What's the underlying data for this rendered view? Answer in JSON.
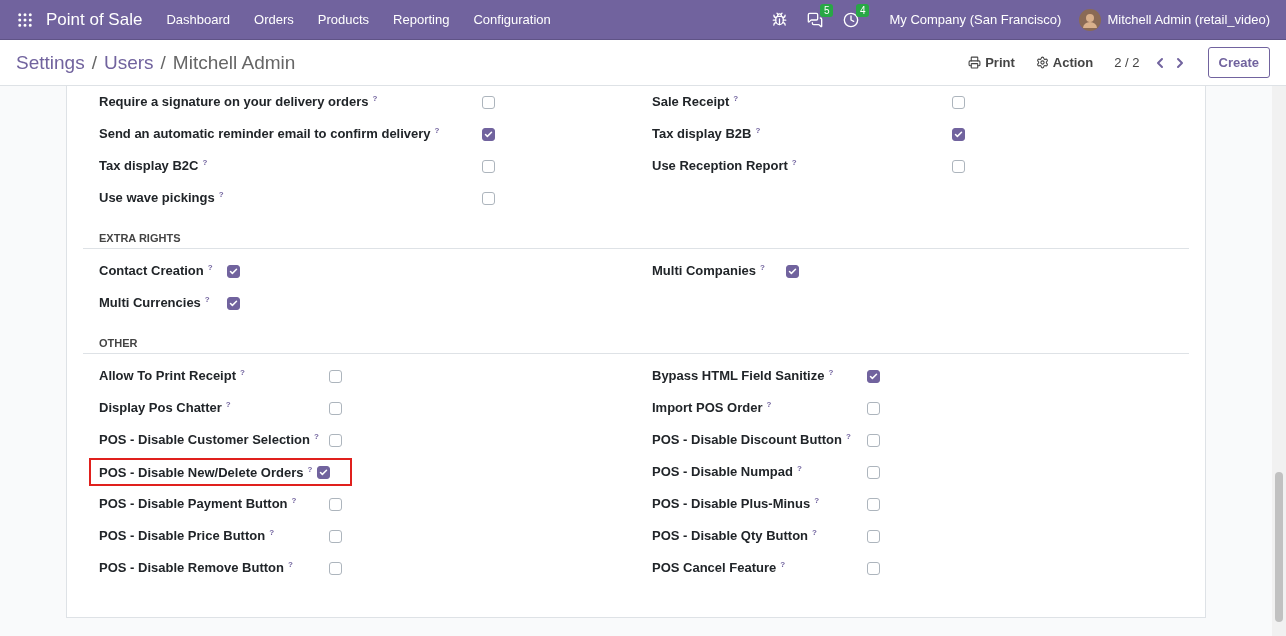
{
  "navbar": {
    "app": "Point of Sale",
    "menu": [
      "Dashboard",
      "Orders",
      "Products",
      "Reporting",
      "Configuration"
    ],
    "messages_badge": "5",
    "activities_badge": "4",
    "company": "My Company (San Francisco)",
    "user": "Mitchell Admin (retail_video)"
  },
  "control_panel": {
    "breadcrumb": [
      {
        "label": "Settings",
        "link": true
      },
      {
        "label": "Users",
        "link": true
      },
      {
        "label": "Mitchell Admin",
        "link": false
      }
    ],
    "separator": "/",
    "print": "Print",
    "action": "Action",
    "pager": "2 / 2",
    "create": "Create"
  },
  "sections": [
    {
      "rows": [
        {
          "left": {
            "label": "Require a signature on your delivery orders",
            "help": "?",
            "checked": false
          },
          "right": {
            "label": "Sale Receipt",
            "help": "?",
            "checked": false
          }
        },
        {
          "left": {
            "label": "Send an automatic reminder email to confirm delivery",
            "help": "?",
            "checked": true
          },
          "right": {
            "label": "Tax display B2B",
            "help": "?",
            "checked": true
          }
        },
        {
          "left": {
            "label": "Tax display B2C",
            "help": "?",
            "checked": false
          },
          "right": {
            "label": "Use Reception Report",
            "help": "?",
            "checked": false
          }
        },
        {
          "left": {
            "label": "Use wave pickings",
            "help": "?",
            "checked": false
          }
        }
      ]
    },
    {
      "title": "EXTRA RIGHTS",
      "rows": [
        {
          "left": {
            "label": "Contact Creation",
            "help": "?",
            "checked": true
          },
          "right": {
            "label": "Multi Companies",
            "help": "?",
            "checked": true
          }
        },
        {
          "left": {
            "label": "Multi Currencies",
            "help": "?",
            "checked": true
          }
        }
      ]
    },
    {
      "title": "OTHER",
      "rows": [
        {
          "left": {
            "label": "Allow To Print Receipt",
            "help": "?",
            "checked": false
          },
          "right": {
            "label": "Bypass HTML Field Sanitize",
            "help": "?",
            "checked": true
          }
        },
        {
          "left": {
            "label": "Display Pos Chatter",
            "help": "?",
            "checked": false
          },
          "right": {
            "label": "Import POS Order",
            "help": "?",
            "checked": false
          }
        },
        {
          "left": {
            "label": "POS - Disable Customer Selection",
            "help": "?",
            "checked": false
          },
          "right": {
            "label": "POS - Disable Discount Button",
            "help": "?",
            "checked": false
          }
        },
        {
          "left": {
            "label": "POS - Disable New/Delete Orders",
            "help": "?",
            "checked": true,
            "highlighted": true
          },
          "right": {
            "label": "POS - Disable Numpad",
            "help": "?",
            "checked": false
          }
        },
        {
          "left": {
            "label": "POS - Disable Payment Button",
            "help": "?",
            "checked": false
          },
          "right": {
            "label": "POS - Disable Plus-Minus",
            "help": "?",
            "checked": false
          }
        },
        {
          "left": {
            "label": "POS - Disable Price Button",
            "help": "?",
            "checked": false
          },
          "right": {
            "label": "POS - Disable Qty Button",
            "help": "?",
            "checked": false
          }
        },
        {
          "left": {
            "label": "POS - Disable Remove Button",
            "help": "?",
            "checked": false
          },
          "right": {
            "label": "POS Cancel Feature",
            "help": "?",
            "checked": false
          }
        }
      ]
    }
  ]
}
